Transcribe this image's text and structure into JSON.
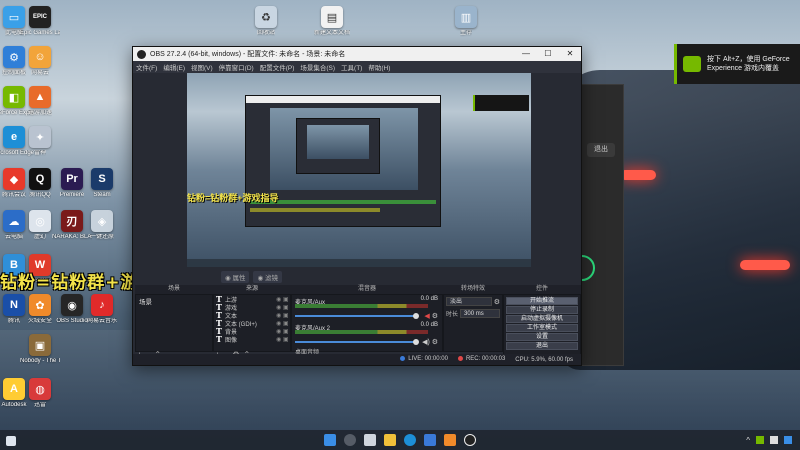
{
  "desktop": {
    "overlay_text": "钻粉=钻粉群+游戏指导",
    "icons": [
      {
        "label": "此电脑",
        "color": "#3aa0e8",
        "glyph": "▭"
      },
      {
        "label": "Epic Games Launcher",
        "color": "#222222",
        "glyph": "EPIC"
      },
      {
        "label": "控制面板",
        "color": "#2f7fd8",
        "glyph": "⚙"
      },
      {
        "label": "网易云",
        "color": "#f2a43a",
        "glyph": "☺"
      },
      {
        "label": "GeForce Experience",
        "color": "#76b900",
        "glyph": "◧"
      },
      {
        "label": "迅游加速",
        "color": "#e86b2a",
        "glyph": "▲"
      },
      {
        "label": "Microsoft Edge",
        "color": "#1d8fd6",
        "glyph": "e"
      },
      {
        "label": "雷神",
        "color": "#b9c3d0",
        "glyph": "✦"
      },
      {
        "label": "腾讯会议",
        "color": "#e8392a",
        "glyph": "◆"
      },
      {
        "label": "腾讯QQ",
        "color": "#111111",
        "glyph": "Q"
      },
      {
        "label": "Premiere",
        "color": "#2b1b52",
        "glyph": "Pr"
      },
      {
        "label": "Steam",
        "color": "#1b3b6a",
        "glyph": "S"
      },
      {
        "label": "云电脑",
        "color": "#2c6dc8",
        "glyph": "☁"
      },
      {
        "label": "虚幻",
        "color": "#dde4ec",
        "glyph": "◎"
      },
      {
        "label": "NARAKA: BLADEPOINT",
        "color": "#7a1a1a",
        "glyph": "刃"
      },
      {
        "label": "一键还原",
        "color": "#c7d2dc",
        "glyph": "◈"
      },
      {
        "label": "Bandizip",
        "color": "#2f8fd8",
        "glyph": "B"
      },
      {
        "label": "WPS Office",
        "color": "#e03a2a",
        "glyph": "W"
      },
      {
        "label": "腾讯",
        "color": "#1a4fa8",
        "glyph": "N"
      },
      {
        "label": "火绒安全",
        "color": "#f08a2a",
        "glyph": "✿"
      },
      {
        "label": "OBS Studio",
        "color": "#262626",
        "glyph": "◉"
      },
      {
        "label": "网易云音乐",
        "color": "#e02a2a",
        "glyph": "♪"
      },
      {
        "label": "Nobody - The Turnaround",
        "color": "#8a6a3a",
        "glyph": "▣"
      },
      {
        "label": "Autodesk",
        "color": "#ffcc33",
        "glyph": "A"
      },
      {
        "label": "迅雷",
        "color": "#d83a3a",
        "glyph": "◍"
      }
    ],
    "top_files": [
      {
        "label": "回收站"
      },
      {
        "label": "主存"
      },
      {
        "label": "新建文本文档"
      }
    ]
  },
  "toast": {
    "message": "按下 Alt+Z，使用 GeForce Experience 游戏内覆盖"
  },
  "obs": {
    "title": "OBS 27.2.4 (64-bit, windows) - 配置文件: 未命名 - 场景: 未命名",
    "menu": [
      "文件(F)",
      "编辑(E)",
      "视图(V)",
      "停靠窗口(D)",
      "配置文件(P)",
      "场景集合(S)",
      "工具(T)",
      "帮助(H)"
    ],
    "scene_tabs": [
      "◉ 属性",
      "◉ 滤镜"
    ],
    "docks": {
      "scenes_header": "场景",
      "sources_header": "来源",
      "mixer_header": "混音器",
      "transitions_header": "转场特效",
      "controls_header": "控件"
    },
    "scenes": [
      "场景"
    ],
    "sources": [
      {
        "name": "上游"
      },
      {
        "name": "游戏"
      },
      {
        "name": "文本"
      },
      {
        "name": "文本 (GDI+)"
      },
      {
        "name": "背景"
      },
      {
        "name": "图像"
      }
    ],
    "mixer": [
      {
        "name": "麦克风/Aux",
        "db": "0.0 dB"
      },
      {
        "name": "麦克风/Aux 2",
        "db": "0.0 dB"
      }
    ],
    "mixer_footer": "桌面音频",
    "transitions": {
      "type": "淡出",
      "duration_label": "时长",
      "duration": "300 ms"
    },
    "controls": [
      "开始推流",
      "停止录制",
      "启动虚拟摄像机",
      "工作室模式",
      "设置",
      "退出"
    ],
    "status": {
      "live": "LIVE: 00:00:00",
      "rec": "REC: 00:00:03",
      "cpu": "CPU: 5.9%, 60.00 fps"
    }
  },
  "bg_window": {
    "button": "退出"
  },
  "taskbar": {
    "tray_time": "^"
  }
}
